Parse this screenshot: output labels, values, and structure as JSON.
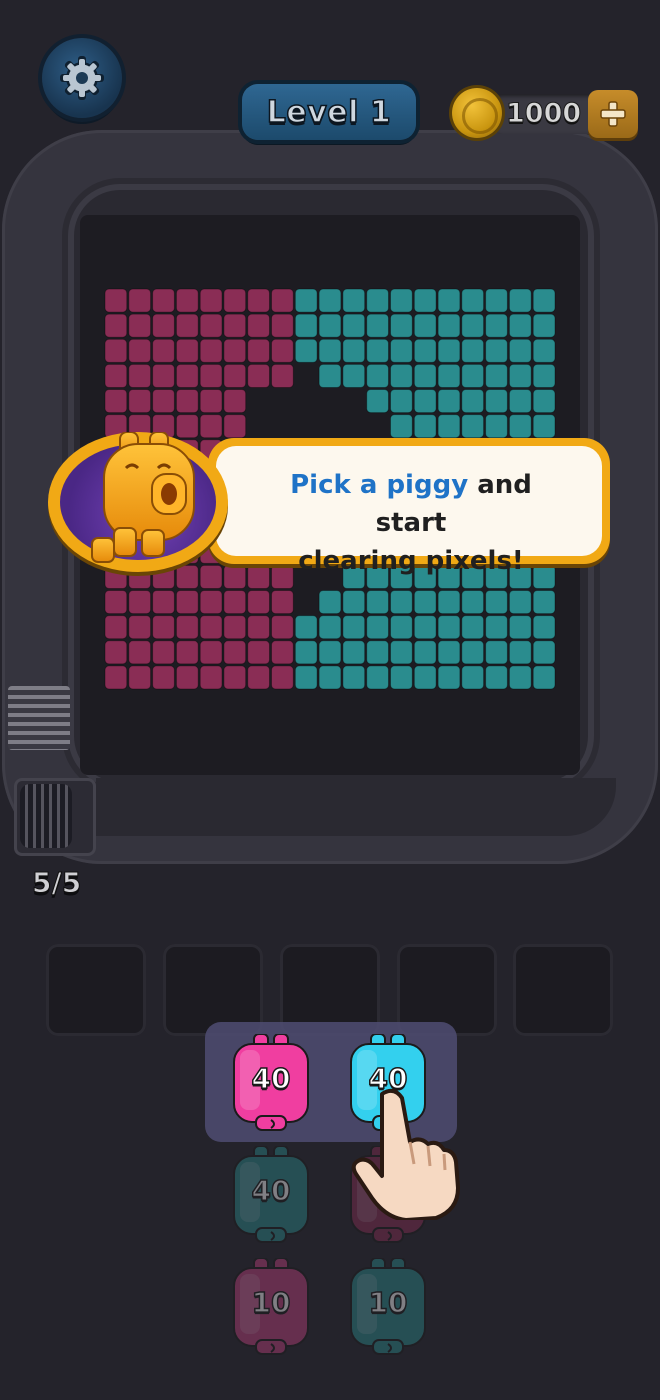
{
  "header": {
    "level_label": "Level 1",
    "coins": "1000"
  },
  "capacity_label": "5/5",
  "tutorial": {
    "highlight": "Pick a piggy",
    "line1_rest": " and start",
    "line2": "clearing pixels!"
  },
  "grid": {
    "colors": {
      "pink": "#8a2d55",
      "teal": "#2a8c8e",
      "empty": "#1d1c22"
    },
    "rows": [
      "ppppppppttttttttttt",
      "ppppppppttttttttttt",
      "ppppppppttttttttttt",
      "pppppppp.tttttttttt",
      "pppppp.....tttttttt",
      "pppppp......ttttttt",
      "pppppp......ttttttt",
      "pppppp......ttttttt",
      "pppppp......ttttttt",
      "pppppp......ttttttt",
      "pppppp......ttttttt",
      "pppppppp..ttttttttt",
      "pppppppp.tttttttttt",
      "ppppppppttttttttttt",
      "ppppppppttttttttttt",
      "ppppppppttttttttttt"
    ]
  },
  "slots": 5,
  "piggies": [
    {
      "id": "pink-40-active",
      "value": "40",
      "color": "#f03ea0",
      "dim": false
    },
    {
      "id": "cyan-40-active",
      "value": "40",
      "color": "#33d0ee",
      "dim": false
    },
    {
      "id": "teal-40",
      "value": "40",
      "color": "#2a8c8e",
      "dim": true
    },
    {
      "id": "pink-dark",
      "value": "",
      "color": "#8a2d55",
      "dim": true
    },
    {
      "id": "pink-10",
      "value": "10",
      "color": "#c2407f",
      "dim": true
    },
    {
      "id": "teal-10",
      "value": "10",
      "color": "#2a8c8e",
      "dim": true
    }
  ]
}
